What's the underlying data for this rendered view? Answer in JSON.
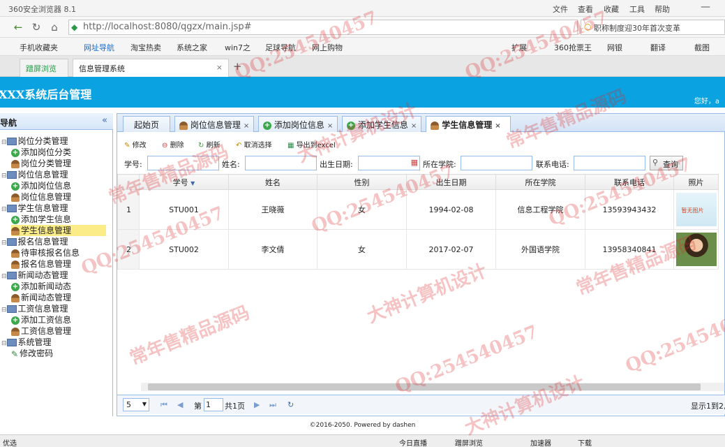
{
  "browser": {
    "title": "360安全浏览器 8.1",
    "menu": [
      "文件",
      "查看",
      "收藏",
      "工具",
      "帮助"
    ],
    "url": "http://localhost:8080/qgzx/main.jsp#",
    "search": "职称制度迎30年首次变革"
  },
  "bookmarks": [
    "手机收藏夹",
    "网址导航",
    "淘宝热卖",
    "系统之家",
    "win7之",
    "足球导航",
    "网上购物"
  ],
  "bookmarks_right": [
    "扩展",
    "360抢票王",
    "网银",
    "翻译",
    "截图"
  ],
  "browser_tabs": [
    "蹭屏浏览",
    "信息管理系统"
  ],
  "header": {
    "title": "XXX系统后台管理",
    "welcome": "您好，a"
  },
  "sidebar": {
    "title": "导航",
    "nodes": [
      {
        "label": "岗位分类管理",
        "type": "folder"
      },
      {
        "label": "添加岗位分类",
        "type": "add"
      },
      {
        "label": "岗位分类管理",
        "type": "user"
      },
      {
        "label": "岗位信息管理",
        "type": "folder"
      },
      {
        "label": "添加岗位信息",
        "type": "add"
      },
      {
        "label": "岗位信息管理",
        "type": "user"
      },
      {
        "label": "学生信息管理",
        "type": "folder"
      },
      {
        "label": "添加学生信息",
        "type": "add"
      },
      {
        "label": "学生信息管理",
        "type": "user"
      },
      {
        "label": "报名信息管理",
        "type": "folder"
      },
      {
        "label": "待审核报名信息",
        "type": "user"
      },
      {
        "label": "报名信息管理",
        "type": "user"
      },
      {
        "label": "新闻动态管理",
        "type": "folder"
      },
      {
        "label": "添加新闻动态",
        "type": "add"
      },
      {
        "label": "新闻动态管理",
        "type": "user"
      },
      {
        "label": "工资信息管理",
        "type": "folder"
      },
      {
        "label": "添加工资信息",
        "type": "add"
      },
      {
        "label": "工资信息管理",
        "type": "user"
      },
      {
        "label": "系统管理",
        "type": "folder"
      },
      {
        "label": "修改密码",
        "type": "edit"
      }
    ]
  },
  "tabs": [
    "起始页",
    "岗位信息管理",
    "添加岗位信息",
    "添加学生信息",
    "学生信息管理"
  ],
  "toolbar": [
    "修改",
    "删除",
    "刷新",
    "取消选择",
    "导出到excel"
  ],
  "filters": [
    "学号:",
    "姓名:",
    "出生日期:",
    "所在学院:",
    "联系电话:"
  ],
  "query": "查询",
  "columns": [
    "学号",
    "姓名",
    "性别",
    "出生日期",
    "所在学院",
    "联系电话",
    "照片"
  ],
  "rows": [
    {
      "n": "1",
      "id": "STU001",
      "name": "王晓薇",
      "sex": "女",
      "birth": "1994-02-08",
      "college": "信息工程学院",
      "phone": "13593943432",
      "photo": "暂无图片"
    },
    {
      "n": "2",
      "id": "STU002",
      "name": "李文倩",
      "sex": "女",
      "birth": "2017-02-07",
      "college": "外国语学院",
      "phone": "13958340841",
      "photo": ""
    }
  ],
  "pager": {
    "size": "5",
    "pre": "第",
    "page": "1",
    "total": "共1页",
    "info": "显示1到2,"
  },
  "footer": "©2016-2050. Powered by dashen",
  "statusbar": [
    "优选",
    "今日直播",
    "蹭屏浏览",
    "加速器",
    "下载"
  ],
  "watermarks": [
    "QQ:254540457",
    "常年售精品源码",
    "大神计算机设计"
  ]
}
